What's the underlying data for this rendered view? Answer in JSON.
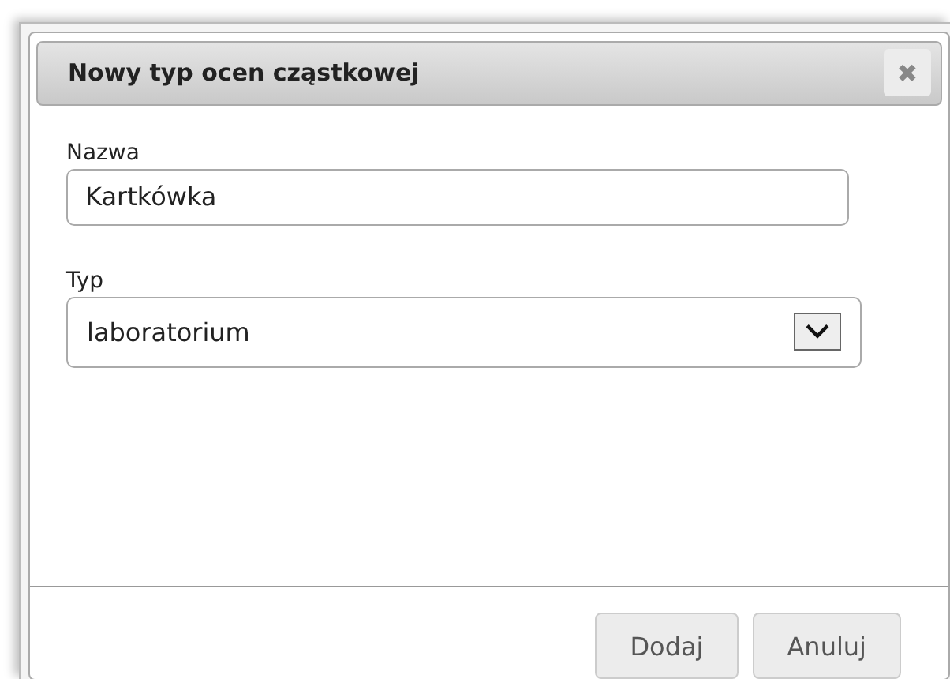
{
  "dialog": {
    "title": "Nowy typ ocen cząstkowej",
    "close_icon": "✖"
  },
  "fields": [
    {
      "kind": "text",
      "label": "Nazwa",
      "value": "Kartkówka"
    },
    {
      "kind": "select",
      "label": "Typ",
      "value": "laboratorium"
    }
  ],
  "buttons": [
    "Dodaj",
    "Anuluj"
  ]
}
